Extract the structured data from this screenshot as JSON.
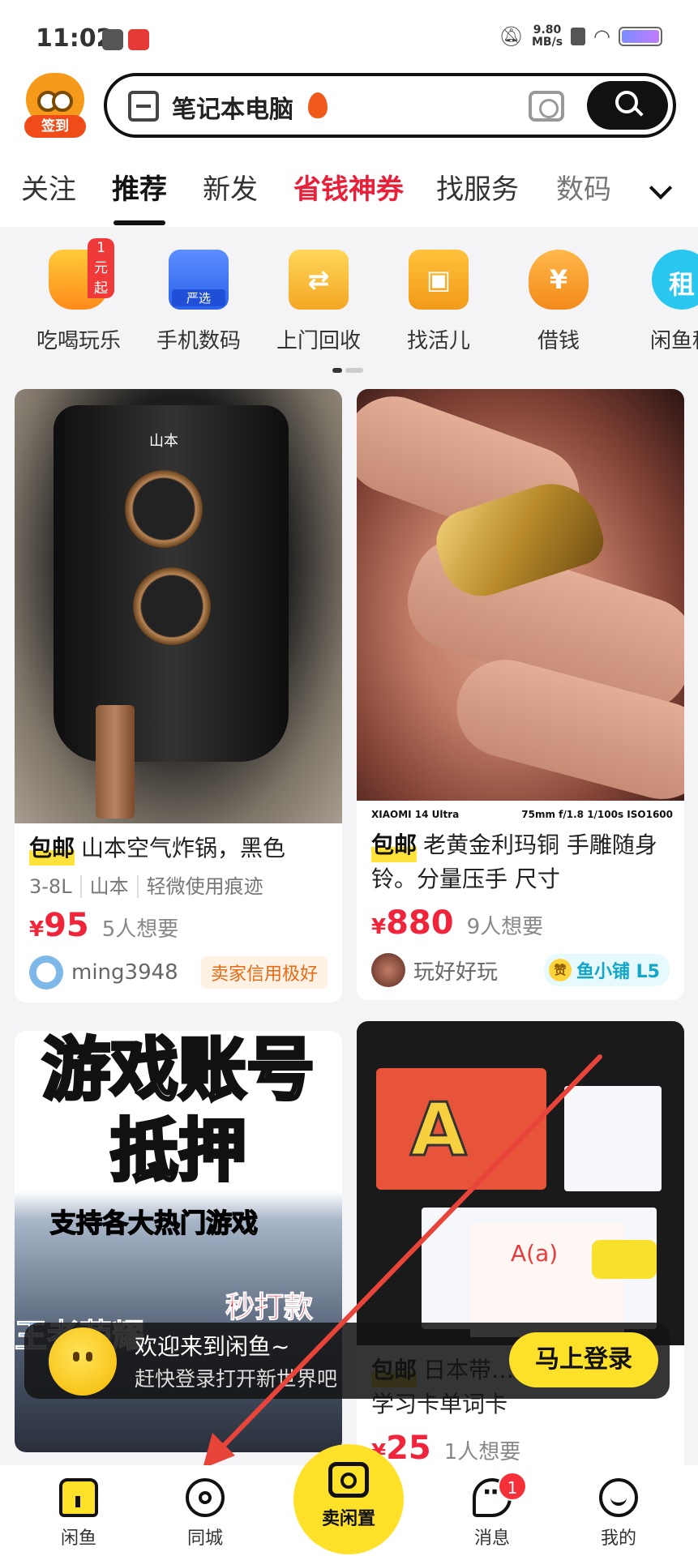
{
  "status_bar": {
    "time": "11:02",
    "net_speed_value": "9.80",
    "net_speed_unit": "MB/s"
  },
  "header": {
    "signin_label": "签到",
    "search_query": "笔记本电脑"
  },
  "tabs": [
    {
      "label": "关注"
    },
    {
      "label": "推荐",
      "active": true
    },
    {
      "label": "新发"
    },
    {
      "label": "省钱神券",
      "promo": true
    },
    {
      "label": "找服务"
    },
    {
      "label": "数码"
    }
  ],
  "categories": [
    {
      "label": "吃喝玩乐",
      "icon": "burger-icon",
      "badge": "1元起"
    },
    {
      "label": "手机数码",
      "icon": "phone-icon",
      "badge": "严选"
    },
    {
      "label": "上门回收",
      "icon": "recycle-box-icon"
    },
    {
      "label": "找活儿",
      "icon": "briefcase-icon"
    },
    {
      "label": "借钱",
      "icon": "money-bag-icon",
      "glyph": "¥"
    },
    {
      "label": "闲鱼租",
      "icon": "rent-icon",
      "glyph": "租"
    }
  ],
  "feed": [
    {
      "tag": "包邮",
      "title": "山本空气炸锅，黑色",
      "attrs": [
        "3-8L",
        "山本",
        "轻微使用痕迹"
      ],
      "price_symbol": "¥",
      "price": "95",
      "wants": "5人想要",
      "seller": "ming3948",
      "seller_badge": "卖家信用极好",
      "image_text": "山本"
    },
    {
      "tag": "包邮",
      "title": "老黄金利玛铜 手雕随身铃。分量压手 尺寸",
      "price_symbol": "¥",
      "price": "880",
      "wants": "9人想要",
      "seller": "玩好好玩",
      "shop_badge_icon": "赞",
      "shop_badge": "鱼小铺 L5",
      "camera_strip_left": "XIAOMI 14 Ultra",
      "camera_strip_right": "75mm f/1.8 1/100s ISO1600"
    },
    {
      "image_title_line1": "游戏账号",
      "image_title_line2": "抵押",
      "image_subtitle": "支持各大热门游戏",
      "image_fast": "秒打款",
      "image_bottom": "王者荣耀"
    },
    {
      "tag": "包邮",
      "title": "日本带……语双语启蒙学习卡单词卡",
      "price_symbol": "¥",
      "price": "25",
      "wants": "1人想要",
      "card_text": "A(a)"
    }
  ],
  "login_prompt": {
    "line1": "欢迎来到闲鱼~",
    "line2": "赶快登录打开新世界吧",
    "button": "马上登录"
  },
  "bottom_nav": {
    "home": "闲鱼",
    "city": "同城",
    "sell": "卖闲置",
    "messages": "消息",
    "messages_badge": "1",
    "me": "我的"
  },
  "colors": {
    "accent": "#ffe12a",
    "price": "#f0243a",
    "promo_tab": "#e8203a",
    "annotation_arrow": "#e8443a"
  }
}
